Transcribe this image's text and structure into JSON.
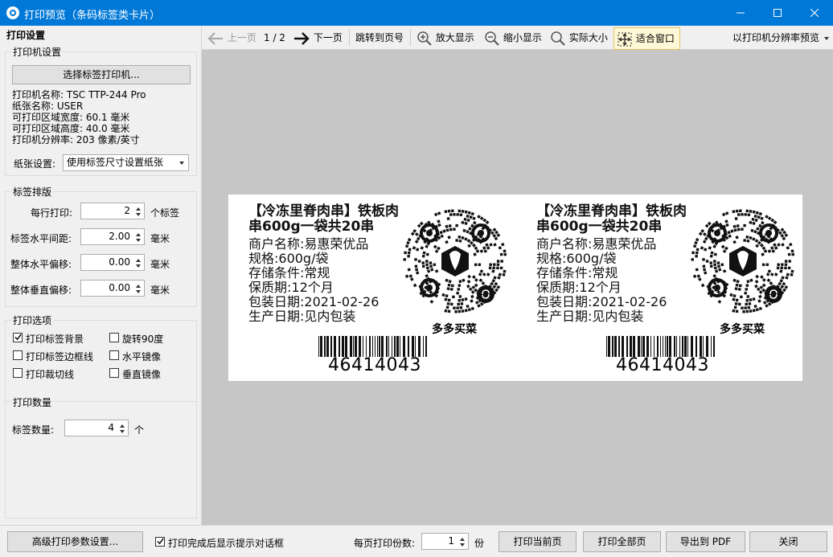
{
  "window": {
    "title": "打印预览（条码标签类卡片）"
  },
  "left_panel": {
    "title": "打印设置",
    "printer_group": {
      "title": "打印机设置",
      "select_button": "选择标签打印机...",
      "info": [
        "打印机名称:  TSC TTP-244 Pro",
        "纸张名称:  USER",
        "可打印区域宽度:  60.1 毫米",
        "可打印区域高度:  40.0 毫米",
        "打印机分辨率:  203 像素/英寸"
      ],
      "paper_label": "纸张设置:",
      "paper_value": "使用标签尺寸设置纸张"
    },
    "layout_group": {
      "title": "标签排版",
      "per_row_label": "每行打印:",
      "per_row_value": "2",
      "per_row_unit": "个标签",
      "h_gap_label": "标签水平间距:",
      "h_gap_value": "2.00",
      "h_gap_unit": "毫米",
      "h_offset_label": "整体水平偏移:",
      "h_offset_value": "0.00",
      "h_offset_unit": "毫米",
      "v_offset_label": "整体垂直偏移:",
      "v_offset_value": "0.00",
      "v_offset_unit": "毫米"
    },
    "options_group": {
      "title": "打印选项",
      "print_background": "打印标签背景",
      "rotate_90": "旋转90度",
      "print_border": "打印标签边框线",
      "h_mirror": "水平镜像",
      "print_cutline": "打印裁切线",
      "v_mirror": "垂直镜像"
    },
    "count_group": {
      "title": "打印数量",
      "count_label": "标签数量:",
      "count_value": "4",
      "count_unit": "个"
    }
  },
  "toolbar": {
    "prev": "上一页",
    "page_indicator": "1 / 2",
    "next": "下一页",
    "goto": "跳转到页号",
    "zoom_in": "放大显示",
    "zoom_out": "缩小显示",
    "actual_size": "实际大小",
    "fit_window": "适合窗口",
    "resolution_preview": "以打印机分辨率预览"
  },
  "labels": [
    {
      "title1": "【冷冻里脊肉串】铁板肉",
      "title2": "串600g一袋共20串",
      "merchant": "商户名称:易惠荣优品",
      "spec": "规格:600g/袋",
      "storage": "存储条件:常规",
      "shelf_life": "保质期:12个月",
      "pack_date": "包装日期:2021-02-26",
      "prod_date": "生产日期:见内包装",
      "qr_caption": "多多买菜",
      "barcode": "46414043"
    },
    {
      "title1": "【冷冻里脊肉串】铁板肉",
      "title2": "串600g一袋共20串",
      "merchant": "商户名称:易惠荣优品",
      "spec": "规格:600g/袋",
      "storage": "存储条件:常规",
      "shelf_life": "保质期:12个月",
      "pack_date": "包装日期:2021-02-26",
      "prod_date": "生产日期:见内包装",
      "qr_caption": "多多买菜",
      "barcode": "46414043"
    }
  ],
  "bottom": {
    "advanced": "高级打印参数设置...",
    "show_dialog": "打印完成后显示提示对话框",
    "copies_label": "每页打印份数:",
    "copies_value": "1",
    "copies_unit": "份",
    "print_current": "打印当前页",
    "print_all": "打印全部页",
    "export_pdf": "导出到 PDF",
    "close": "关闭"
  }
}
